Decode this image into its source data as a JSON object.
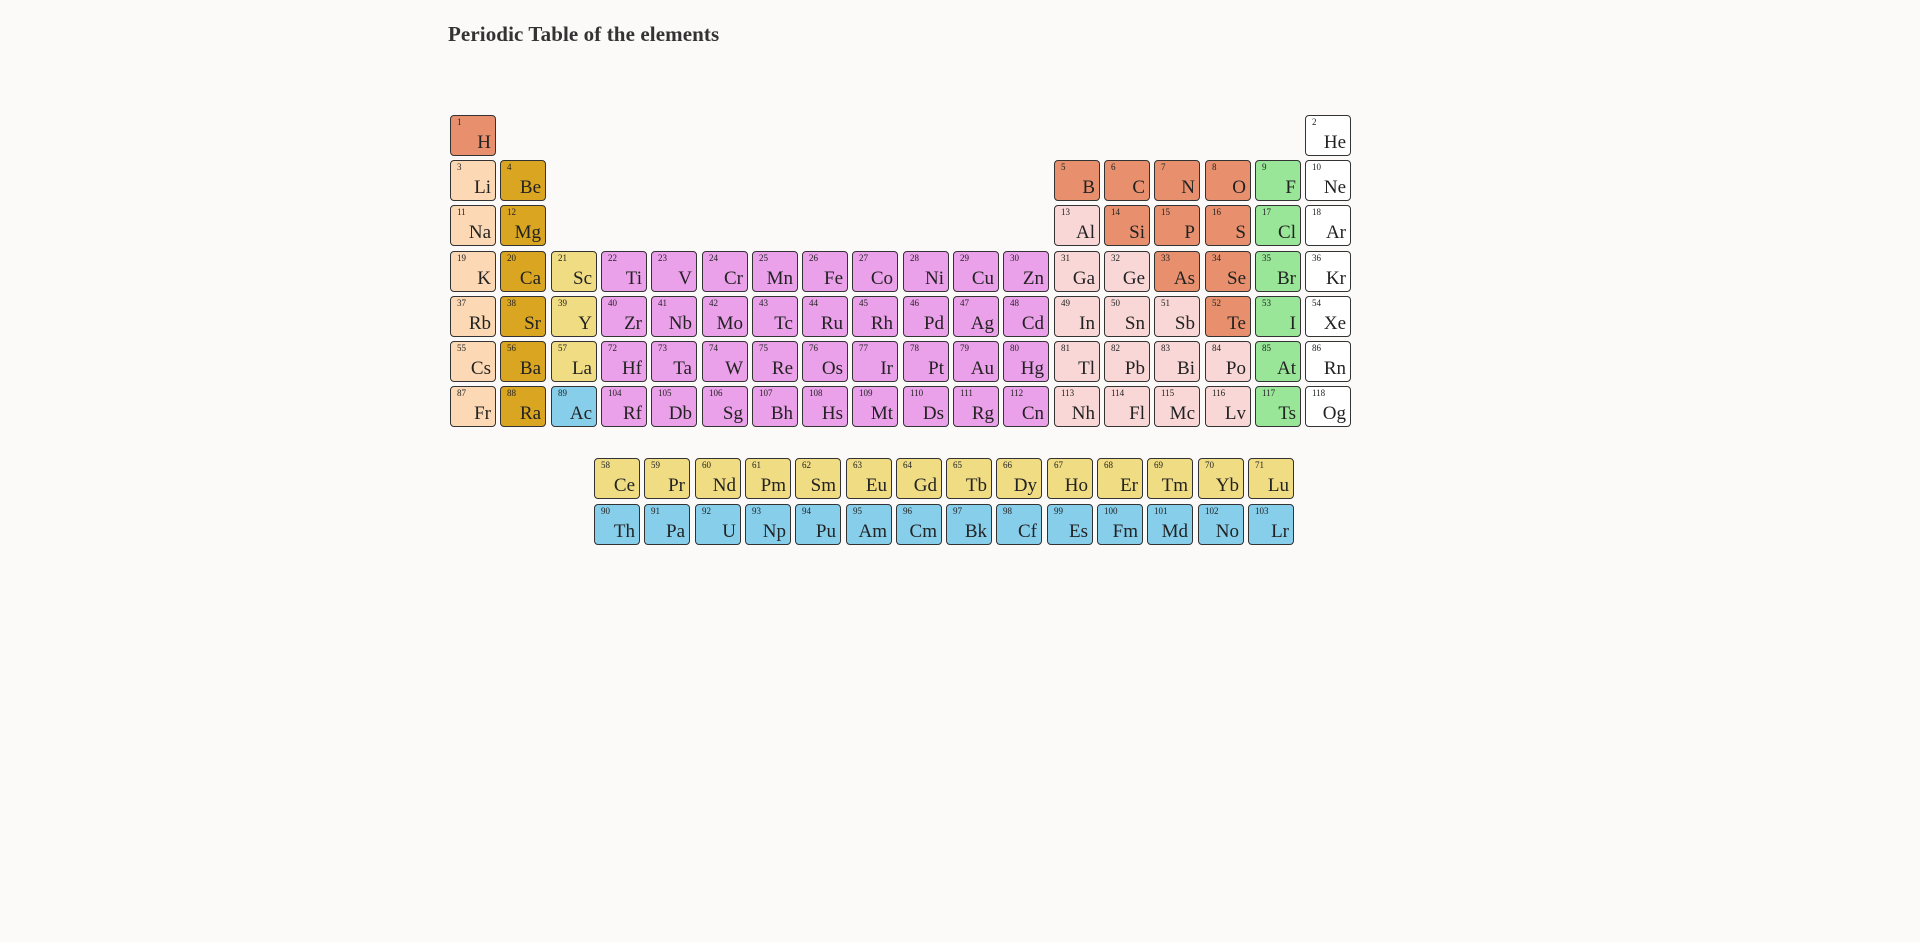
{
  "page": {
    "title": "Periodic Table of the elements"
  },
  "colors": {
    "diatomic_nonmetal": "#e8906e",
    "alkali_metal": "#fcd8b4",
    "alkaline_earth_metal": "#daa520",
    "lanthanide": "#f0dc82",
    "actinide": "#87ceeb",
    "transition_metal": "#eba0ea",
    "post_transition_metal": "#f9d7d7",
    "halogen": "#99e699",
    "noble_gas": "#ffffff"
  },
  "main_table": [
    {
      "n": "1",
      "s": "H",
      "c": "diatomic_nonmetal",
      "row": 1,
      "col": 1
    },
    {
      "n": "2",
      "s": "He",
      "c": "noble_gas",
      "row": 1,
      "col": 18
    },
    {
      "n": "3",
      "s": "Li",
      "c": "alkali_metal",
      "row": 2,
      "col": 1
    },
    {
      "n": "4",
      "s": "Be",
      "c": "alkaline_earth_metal",
      "row": 2,
      "col": 2
    },
    {
      "n": "5",
      "s": "B",
      "c": "diatomic_nonmetal",
      "row": 2,
      "col": 13
    },
    {
      "n": "6",
      "s": "C",
      "c": "diatomic_nonmetal",
      "row": 2,
      "col": 14
    },
    {
      "n": "7",
      "s": "N",
      "c": "diatomic_nonmetal",
      "row": 2,
      "col": 15
    },
    {
      "n": "8",
      "s": "O",
      "c": "diatomic_nonmetal",
      "row": 2,
      "col": 16
    },
    {
      "n": "9",
      "s": "F",
      "c": "halogen",
      "row": 2,
      "col": 17
    },
    {
      "n": "10",
      "s": "Ne",
      "c": "noble_gas",
      "row": 2,
      "col": 18
    },
    {
      "n": "11",
      "s": "Na",
      "c": "alkali_metal",
      "row": 3,
      "col": 1
    },
    {
      "n": "12",
      "s": "Mg",
      "c": "alkaline_earth_metal",
      "row": 3,
      "col": 2
    },
    {
      "n": "13",
      "s": "Al",
      "c": "post_transition_metal",
      "row": 3,
      "col": 13
    },
    {
      "n": "14",
      "s": "Si",
      "c": "diatomic_nonmetal",
      "row": 3,
      "col": 14
    },
    {
      "n": "15",
      "s": "P",
      "c": "diatomic_nonmetal",
      "row": 3,
      "col": 15
    },
    {
      "n": "16",
      "s": "S",
      "c": "diatomic_nonmetal",
      "row": 3,
      "col": 16
    },
    {
      "n": "17",
      "s": "Cl",
      "c": "halogen",
      "row": 3,
      "col": 17
    },
    {
      "n": "18",
      "s": "Ar",
      "c": "noble_gas",
      "row": 3,
      "col": 18
    },
    {
      "n": "19",
      "s": "K",
      "c": "alkali_metal",
      "row": 4,
      "col": 1
    },
    {
      "n": "20",
      "s": "Ca",
      "c": "alkaline_earth_metal",
      "row": 4,
      "col": 2
    },
    {
      "n": "21",
      "s": "Sc",
      "c": "lanthanide",
      "row": 4,
      "col": 3
    },
    {
      "n": "22",
      "s": "Ti",
      "c": "transition_metal",
      "row": 4,
      "col": 4
    },
    {
      "n": "23",
      "s": "V",
      "c": "transition_metal",
      "row": 4,
      "col": 5
    },
    {
      "n": "24",
      "s": "Cr",
      "c": "transition_metal",
      "row": 4,
      "col": 6
    },
    {
      "n": "25",
      "s": "Mn",
      "c": "transition_metal",
      "row": 4,
      "col": 7
    },
    {
      "n": "26",
      "s": "Fe",
      "c": "transition_metal",
      "row": 4,
      "col": 8
    },
    {
      "n": "27",
      "s": "Co",
      "c": "transition_metal",
      "row": 4,
      "col": 9
    },
    {
      "n": "28",
      "s": "Ni",
      "c": "transition_metal",
      "row": 4,
      "col": 10
    },
    {
      "n": "29",
      "s": "Cu",
      "c": "transition_metal",
      "row": 4,
      "col": 11
    },
    {
      "n": "30",
      "s": "Zn",
      "c": "transition_metal",
      "row": 4,
      "col": 12
    },
    {
      "n": "31",
      "s": "Ga",
      "c": "post_transition_metal",
      "row": 4,
      "col": 13
    },
    {
      "n": "32",
      "s": "Ge",
      "c": "post_transition_metal",
      "row": 4,
      "col": 14
    },
    {
      "n": "33",
      "s": "As",
      "c": "diatomic_nonmetal",
      "row": 4,
      "col": 15
    },
    {
      "n": "34",
      "s": "Se",
      "c": "diatomic_nonmetal",
      "row": 4,
      "col": 16
    },
    {
      "n": "35",
      "s": "Br",
      "c": "halogen",
      "row": 4,
      "col": 17
    },
    {
      "n": "36",
      "s": "Kr",
      "c": "noble_gas",
      "row": 4,
      "col": 18
    },
    {
      "n": "37",
      "s": "Rb",
      "c": "alkali_metal",
      "row": 5,
      "col": 1
    },
    {
      "n": "38",
      "s": "Sr",
      "c": "alkaline_earth_metal",
      "row": 5,
      "col": 2
    },
    {
      "n": "39",
      "s": "Y",
      "c": "lanthanide",
      "row": 5,
      "col": 3
    },
    {
      "n": "40",
      "s": "Zr",
      "c": "transition_metal",
      "row": 5,
      "col": 4
    },
    {
      "n": "41",
      "s": "Nb",
      "c": "transition_metal",
      "row": 5,
      "col": 5
    },
    {
      "n": "42",
      "s": "Mo",
      "c": "transition_metal",
      "row": 5,
      "col": 6
    },
    {
      "n": "43",
      "s": "Tc",
      "c": "transition_metal",
      "row": 5,
      "col": 7
    },
    {
      "n": "44",
      "s": "Ru",
      "c": "transition_metal",
      "row": 5,
      "col": 8
    },
    {
      "n": "45",
      "s": "Rh",
      "c": "transition_metal",
      "row": 5,
      "col": 9
    },
    {
      "n": "46",
      "s": "Pd",
      "c": "transition_metal",
      "row": 5,
      "col": 10
    },
    {
      "n": "47",
      "s": "Ag",
      "c": "transition_metal",
      "row": 5,
      "col": 11
    },
    {
      "n": "48",
      "s": "Cd",
      "c": "transition_metal",
      "row": 5,
      "col": 12
    },
    {
      "n": "49",
      "s": "In",
      "c": "post_transition_metal",
      "row": 5,
      "col": 13
    },
    {
      "n": "50",
      "s": "Sn",
      "c": "post_transition_metal",
      "row": 5,
      "col": 14
    },
    {
      "n": "51",
      "s": "Sb",
      "c": "post_transition_metal",
      "row": 5,
      "col": 15
    },
    {
      "n": "52",
      "s": "Te",
      "c": "diatomic_nonmetal",
      "row": 5,
      "col": 16
    },
    {
      "n": "53",
      "s": "I",
      "c": "halogen",
      "row": 5,
      "col": 17
    },
    {
      "n": "54",
      "s": "Xe",
      "c": "noble_gas",
      "row": 5,
      "col": 18
    },
    {
      "n": "55",
      "s": "Cs",
      "c": "alkali_metal",
      "row": 6,
      "col": 1
    },
    {
      "n": "56",
      "s": "Ba",
      "c": "alkaline_earth_metal",
      "row": 6,
      "col": 2
    },
    {
      "n": "57",
      "s": "La",
      "c": "lanthanide",
      "row": 6,
      "col": 3
    },
    {
      "n": "72",
      "s": "Hf",
      "c": "transition_metal",
      "row": 6,
      "col": 4
    },
    {
      "n": "73",
      "s": "Ta",
      "c": "transition_metal",
      "row": 6,
      "col": 5
    },
    {
      "n": "74",
      "s": "W",
      "c": "transition_metal",
      "row": 6,
      "col": 6
    },
    {
      "n": "75",
      "s": "Re",
      "c": "transition_metal",
      "row": 6,
      "col": 7
    },
    {
      "n": "76",
      "s": "Os",
      "c": "transition_metal",
      "row": 6,
      "col": 8
    },
    {
      "n": "77",
      "s": "Ir",
      "c": "transition_metal",
      "row": 6,
      "col": 9
    },
    {
      "n": "78",
      "s": "Pt",
      "c": "transition_metal",
      "row": 6,
      "col": 10
    },
    {
      "n": "79",
      "s": "Au",
      "c": "transition_metal",
      "row": 6,
      "col": 11
    },
    {
      "n": "80",
      "s": "Hg",
      "c": "transition_metal",
      "row": 6,
      "col": 12
    },
    {
      "n": "81",
      "s": "Tl",
      "c": "post_transition_metal",
      "row": 6,
      "col": 13
    },
    {
      "n": "82",
      "s": "Pb",
      "c": "post_transition_metal",
      "row": 6,
      "col": 14
    },
    {
      "n": "83",
      "s": "Bi",
      "c": "post_transition_metal",
      "row": 6,
      "col": 15
    },
    {
      "n": "84",
      "s": "Po",
      "c": "post_transition_metal",
      "row": 6,
      "col": 16
    },
    {
      "n": "85",
      "s": "At",
      "c": "halogen",
      "row": 6,
      "col": 17
    },
    {
      "n": "86",
      "s": "Rn",
      "c": "noble_gas",
      "row": 6,
      "col": 18
    },
    {
      "n": "87",
      "s": "Fr",
      "c": "alkali_metal",
      "row": 7,
      "col": 1
    },
    {
      "n": "88",
      "s": "Ra",
      "c": "alkaline_earth_metal",
      "row": 7,
      "col": 2
    },
    {
      "n": "89",
      "s": "Ac",
      "c": "actinide",
      "row": 7,
      "col": 3
    },
    {
      "n": "104",
      "s": "Rf",
      "c": "transition_metal",
      "row": 7,
      "col": 4
    },
    {
      "n": "105",
      "s": "Db",
      "c": "transition_metal",
      "row": 7,
      "col": 5
    },
    {
      "n": "106",
      "s": "Sg",
      "c": "transition_metal",
      "row": 7,
      "col": 6
    },
    {
      "n": "107",
      "s": "Bh",
      "c": "transition_metal",
      "row": 7,
      "col": 7
    },
    {
      "n": "108",
      "s": "Hs",
      "c": "transition_metal",
      "row": 7,
      "col": 8
    },
    {
      "n": "109",
      "s": "Mt",
      "c": "transition_metal",
      "row": 7,
      "col": 9
    },
    {
      "n": "110",
      "s": "Ds",
      "c": "transition_metal",
      "row": 7,
      "col": 10
    },
    {
      "n": "111",
      "s": "Rg",
      "c": "transition_metal",
      "row": 7,
      "col": 11
    },
    {
      "n": "112",
      "s": "Cn",
      "c": "transition_metal",
      "row": 7,
      "col": 12
    },
    {
      "n": "113",
      "s": "Nh",
      "c": "post_transition_metal",
      "row": 7,
      "col": 13
    },
    {
      "n": "114",
      "s": "Fl",
      "c": "post_transition_metal",
      "row": 7,
      "col": 14
    },
    {
      "n": "115",
      "s": "Mc",
      "c": "post_transition_metal",
      "row": 7,
      "col": 15
    },
    {
      "n": "116",
      "s": "Lv",
      "c": "post_transition_metal",
      "row": 7,
      "col": 16
    },
    {
      "n": "117",
      "s": "Ts",
      "c": "halogen",
      "row": 7,
      "col": 17
    },
    {
      "n": "118",
      "s": "Og",
      "c": "noble_gas",
      "row": 7,
      "col": 18
    }
  ],
  "lanthanides": [
    {
      "n": "58",
      "s": "Ce"
    },
    {
      "n": "59",
      "s": "Pr"
    },
    {
      "n": "60",
      "s": "Nd"
    },
    {
      "n": "61",
      "s": "Pm"
    },
    {
      "n": "62",
      "s": "Sm"
    },
    {
      "n": "63",
      "s": "Eu"
    },
    {
      "n": "64",
      "s": "Gd"
    },
    {
      "n": "65",
      "s": "Tb"
    },
    {
      "n": "66",
      "s": "Dy"
    },
    {
      "n": "67",
      "s": "Ho"
    },
    {
      "n": "68",
      "s": "Er"
    },
    {
      "n": "69",
      "s": "Tm"
    },
    {
      "n": "70",
      "s": "Yb"
    },
    {
      "n": "71",
      "s": "Lu"
    }
  ],
  "actinides": [
    {
      "n": "90",
      "s": "Th"
    },
    {
      "n": "91",
      "s": "Pa"
    },
    {
      "n": "92",
      "s": "U"
    },
    {
      "n": "93",
      "s": "Np"
    },
    {
      "n": "94",
      "s": "Pu"
    },
    {
      "n": "95",
      "s": "Am"
    },
    {
      "n": "96",
      "s": "Cm"
    },
    {
      "n": "97",
      "s": "Bk"
    },
    {
      "n": "98",
      "s": "Cf"
    },
    {
      "n": "99",
      "s": "Es"
    },
    {
      "n": "100",
      "s": "Fm"
    },
    {
      "n": "101",
      "s": "Md"
    },
    {
      "n": "102",
      "s": "No"
    },
    {
      "n": "103",
      "s": "Lr"
    }
  ]
}
